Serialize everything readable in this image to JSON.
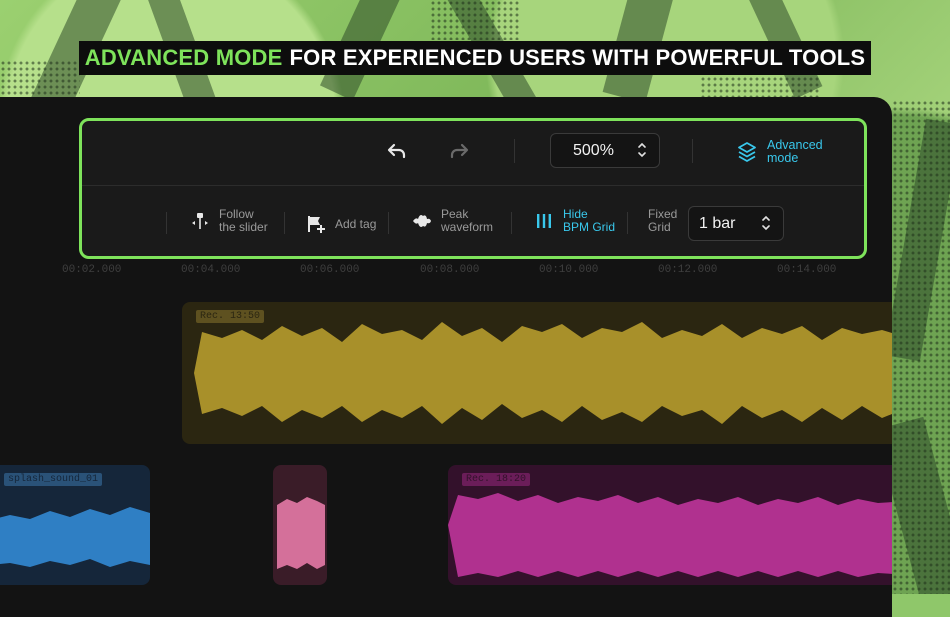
{
  "headline": {
    "highlight": "ADVANCED MODE",
    "rest": "FOR EXPERIENCED USERS WITH POWERFUL TOOLS"
  },
  "toolbar": {
    "zoom_value": "500%",
    "advanced_mode": {
      "line1": "Advanced",
      "line2": "mode"
    },
    "follow_slider": {
      "line1": "Follow",
      "line2": "the slider"
    },
    "add_tag": "Add tag",
    "peak_waveform": {
      "line1": "Peak",
      "line2": "waveform"
    },
    "hide_bpm_grid": {
      "line1": "Hide",
      "line2": "BPM Grid"
    },
    "fixed_grid": {
      "line1": "Fixed",
      "line2": "Grid"
    },
    "grid_value": "1 bar"
  },
  "ruler": {
    "labels": [
      "00:02.000",
      "00:04.000",
      "00:06.000",
      "00:08.000",
      "00:10.000",
      "00:12.000",
      "00:14.000"
    ]
  },
  "tracks": {
    "yellow_label": "Rec. 13:50",
    "blue_label": "splash_sound_01",
    "magenta_label": "Rec. 18:20"
  },
  "colors": {
    "accent_green": "#7ee35b",
    "accent_cyan": "#39c8ec",
    "yellow_clip": "#a8902a",
    "blue_clip": "#2f7fc4",
    "pink_clip": "#d4709a",
    "magenta_clip": "#b0318f"
  }
}
